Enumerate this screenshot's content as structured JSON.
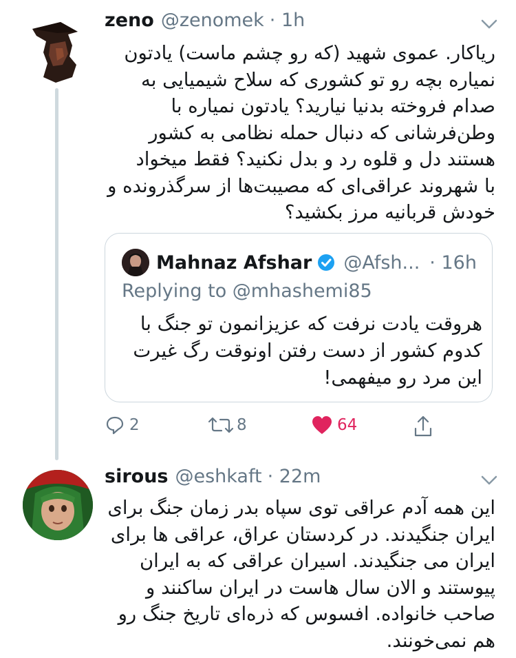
{
  "tweet1": {
    "name": "zeno",
    "handle": "@zenomek",
    "time": "· 1h",
    "lines": [
      "ریاکار. عموی شهید (که رو چشم ماست) یادتون",
      "نمیاره بچه رو تو کشوری که سلاح شیمیایی به",
      "صدام فروخته بدنیا نیارید؟ یادتون نمیاره با",
      "وطن‌فرشانی که دنبال حمله نظامی به کشور",
      "هستند دل و قلوه رد و بدل نکنید؟ فقط میخواد",
      "با شهروند عراقی‌ای که مصیبت‌ها از سرگذرونده و",
      "خودش قربانیه مرز بکشید؟"
    ],
    "quoted": {
      "name": "Mahnaz Afshar",
      "handle": "@Afsh...",
      "time": "· 16h",
      "replying": "Replying to @mhashemi85",
      "lines": [
        "هروقت یادت نرفت که عزیزانمون تو جنگ با",
        "کدوم کشور از دست رفتن اونوقت رگ غیرت",
        "این مرد رو میفهمی!"
      ]
    },
    "actions": {
      "replies": "2",
      "retweets": "8",
      "likes": "64",
      "like_color": "#e0245e"
    }
  },
  "tweet2": {
    "name": "sirous",
    "handle": "@eshkaft",
    "time": "· 22m",
    "lines": [
      "این همه آدم عراقی توی سپاه بدر زمان جنگ برای",
      "ایران جنگیدند. در کردستان عراق، عراقی ها برای",
      "ایران می جنگیدند. اسیران عراقی که به ایران",
      "پیوستند و الان سال هاست در ایران ساکنند و",
      "صاحب خانواده. افسوس که ذره‌ای تاریخ جنگ رو",
      "هم نمی‌خونند."
    ]
  },
  "icons": {
    "reply": "comment-icon",
    "retweet": "retweet-icon",
    "like": "heart-icon",
    "share": "share-icon",
    "menu": "chevron-down-icon",
    "verified": "verified-badge-icon"
  }
}
